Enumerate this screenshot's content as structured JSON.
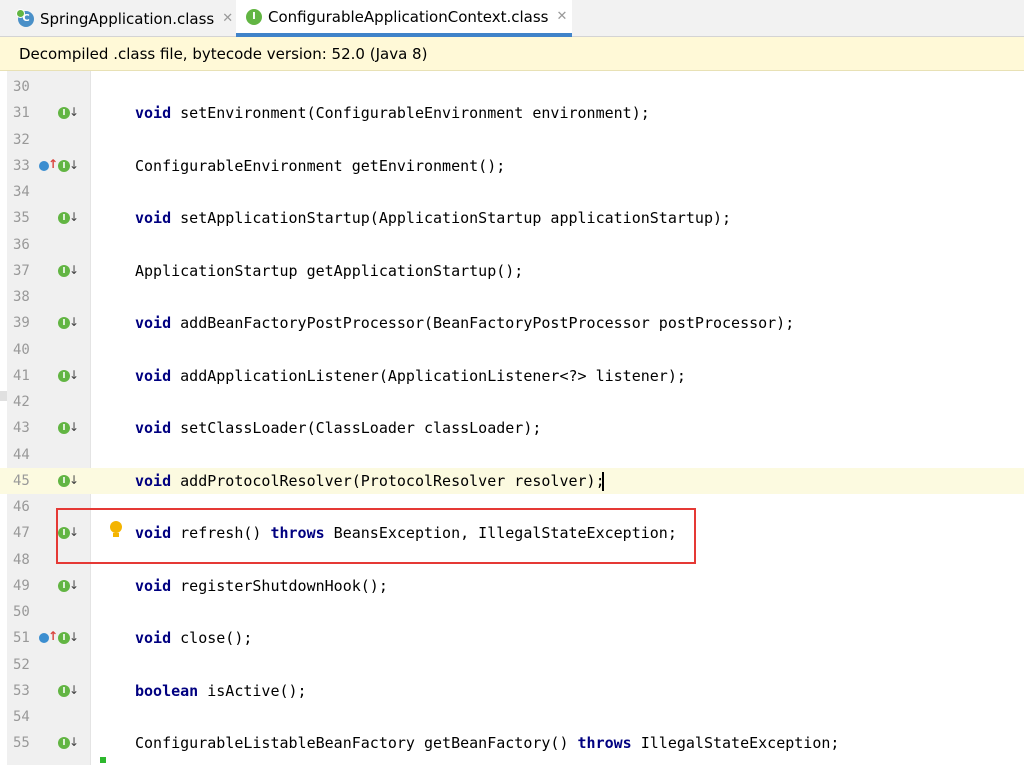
{
  "tabs": [
    {
      "label": "SpringApplication.class",
      "icon": "class-icon",
      "active": false
    },
    {
      "label": "ConfigurableApplicationContext.class",
      "icon": "interface-icon",
      "active": true
    }
  ],
  "info_bar": {
    "text": "Decompiled .class file, bytecode version: 52.0 (Java 8)"
  },
  "editor": {
    "current_line": 45,
    "lines": [
      {
        "num": "30",
        "code": []
      },
      {
        "num": "31",
        "code": [
          {
            "kw": "void"
          },
          {
            "t": " setEnvironment(ConfigurableEnvironment environment);"
          }
        ],
        "impl": true
      },
      {
        "num": "32",
        "code": []
      },
      {
        "num": "33",
        "code": [
          {
            "t": "ConfigurableEnvironment getEnvironment();"
          }
        ],
        "impl": true,
        "override": true
      },
      {
        "num": "34",
        "code": []
      },
      {
        "num": "35",
        "code": [
          {
            "kw": "void"
          },
          {
            "t": " setApplicationStartup(ApplicationStartup applicationStartup);"
          }
        ],
        "impl": true
      },
      {
        "num": "36",
        "code": []
      },
      {
        "num": "37",
        "code": [
          {
            "t": "ApplicationStartup getApplicationStartup();"
          }
        ],
        "impl": true
      },
      {
        "num": "38",
        "code": []
      },
      {
        "num": "39",
        "code": [
          {
            "kw": "void"
          },
          {
            "t": " addBeanFactoryPostProcessor(BeanFactoryPostProcessor postProcessor);"
          }
        ],
        "impl": true
      },
      {
        "num": "40",
        "code": []
      },
      {
        "num": "41",
        "code": [
          {
            "kw": "void"
          },
          {
            "t": " addApplicationListener(ApplicationListener<?> listener);"
          }
        ],
        "impl": true
      },
      {
        "num": "42",
        "code": []
      },
      {
        "num": "43",
        "code": [
          {
            "kw": "void"
          },
          {
            "t": " setClassLoader(ClassLoader classLoader);"
          }
        ],
        "impl": true
      },
      {
        "num": "44",
        "code": []
      },
      {
        "num": "45",
        "code": [
          {
            "kw": "void"
          },
          {
            "t": " addProtocolResolver(ProtocolResolver resolver);"
          }
        ],
        "impl": true
      },
      {
        "num": "46",
        "code": []
      },
      {
        "num": "47",
        "code": [
          {
            "kw": "void"
          },
          {
            "t": " refresh() "
          },
          {
            "kw": "throws"
          },
          {
            "t": " BeansException, IllegalStateException;"
          }
        ],
        "impl": true
      },
      {
        "num": "48",
        "code": []
      },
      {
        "num": "49",
        "code": [
          {
            "kw": "void"
          },
          {
            "t": " registerShutdownHook();"
          }
        ],
        "impl": true
      },
      {
        "num": "50",
        "code": []
      },
      {
        "num": "51",
        "code": [
          {
            "kw": "void"
          },
          {
            "t": " close();"
          }
        ],
        "impl": true,
        "override": true
      },
      {
        "num": "52",
        "code": []
      },
      {
        "num": "53",
        "code": [
          {
            "kw": "boolean"
          },
          {
            "t": " isActive();"
          }
        ],
        "impl": true
      },
      {
        "num": "54",
        "code": []
      },
      {
        "num": "55",
        "code": [
          {
            "t": "ConfigurableListableBeanFactory getBeanFactory() "
          },
          {
            "kw": "throws"
          },
          {
            "t": " IllegalStateException;"
          }
        ],
        "impl": true
      }
    ]
  },
  "colors": {
    "keyword": "#000080",
    "highlight_box": "#e53935",
    "current_line": "#fcfae0",
    "info_bar": "#fff9d7"
  }
}
